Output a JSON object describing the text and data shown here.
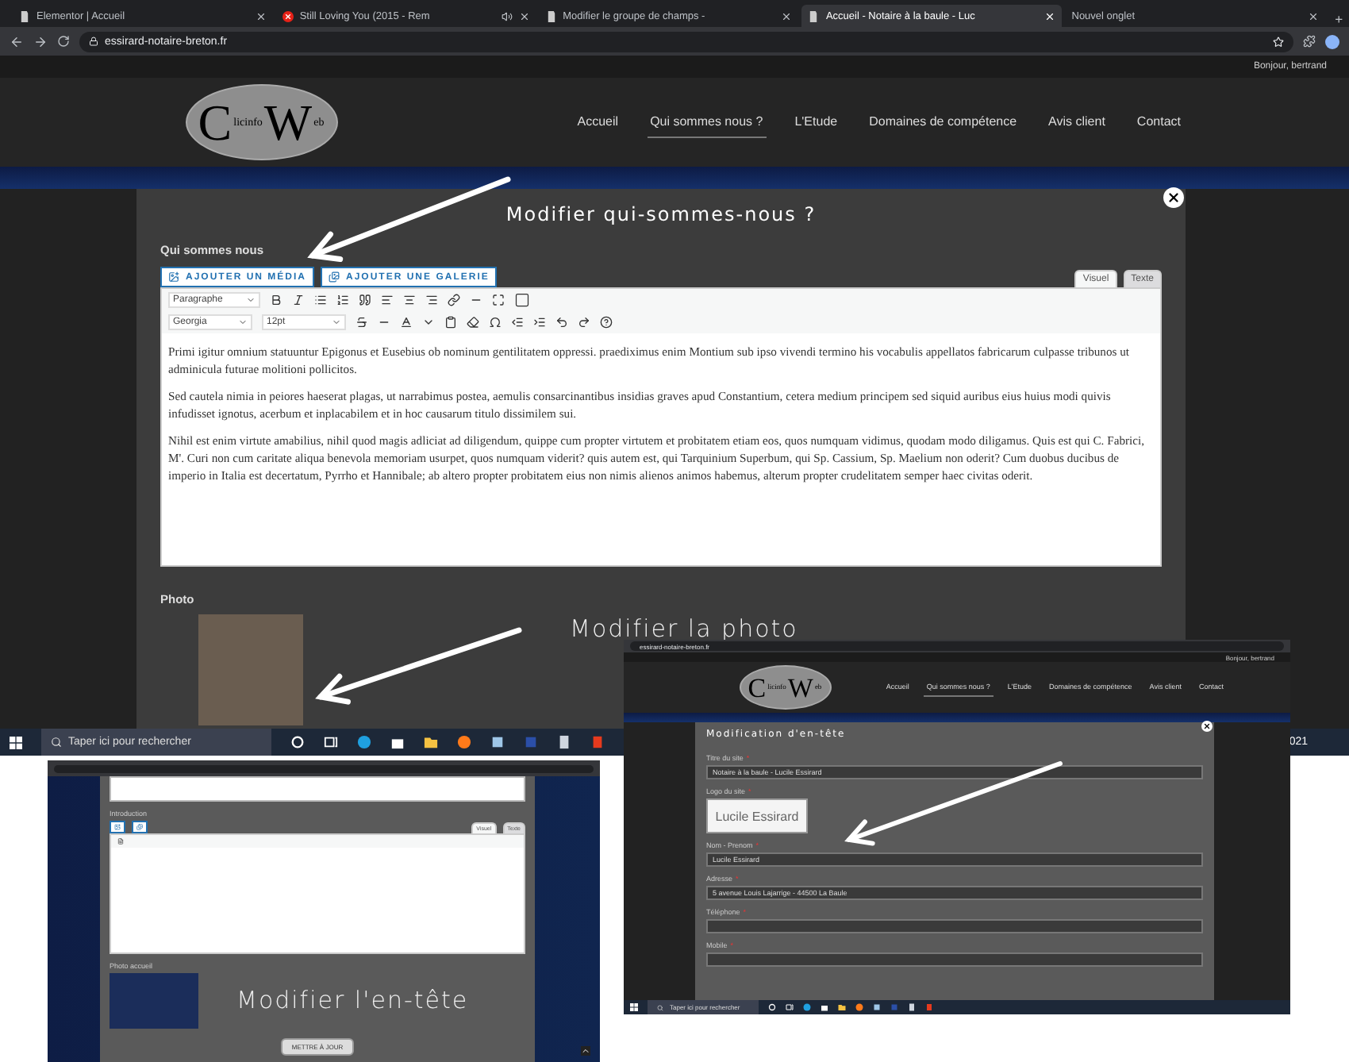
{
  "browser": {
    "tabs": [
      {
        "title": "Elementor | Accueil",
        "kind": "page",
        "selected": false
      },
      {
        "title": "Still Loving You (2015 - Rem",
        "kind": "video",
        "selected": false
      },
      {
        "title": "Modifier le groupe de champs -",
        "kind": "page",
        "selected": false
      },
      {
        "title": "Accueil - Notaire à la baule - Luc",
        "kind": "page",
        "selected": true
      },
      {
        "title": "Nouvel onglet",
        "kind": "blank",
        "selected": false
      }
    ],
    "new_tab": "+",
    "url": "essirard-notaire-breton.fr"
  },
  "site": {
    "greeting": "Bonjour, bertrand",
    "logo": {
      "initial": "C",
      "initial_tail": "licinfo",
      "second": "W",
      "second_tail": "eb"
    },
    "nav": [
      {
        "label": "Accueil",
        "selected": false
      },
      {
        "label": "Qui sommes nous ?",
        "selected": true
      },
      {
        "label": "L'Etude",
        "selected": false
      },
      {
        "label": "Domaines de compétence",
        "selected": false
      },
      {
        "label": "Avis client",
        "selected": false
      },
      {
        "label": "Contact",
        "selected": false
      }
    ]
  },
  "modal": {
    "title": "Modifier qui-sommes-nous ?",
    "field_label": "Qui sommes nous",
    "media_buttons": [
      "AJOUTER UN MÉDIA",
      "AJOUTER UNE GALERIE"
    ],
    "editor_tabs": [
      {
        "label": "Visuel",
        "selected": true
      },
      {
        "label": "Texte",
        "selected": false
      }
    ],
    "format_select": "Paragraphe",
    "font_select": "Georgia",
    "size_select": "12pt",
    "paragraphs": [
      "Primi igitur omnium statuuntur Epigonus et Eusebius ob nominum gentilitatem oppressi. praediximus enim Montium sub ipso vivendi termino his vocabulis appellatos fabricarum culpasse tribunos ut adminicula futurae molitioni pollicitos.",
      "Sed cautela nimia in peiores haeserat plagas, ut narrabimus postea, aemulis consarcinantibus insidias graves apud Constantium, cetera medium principem sed siquid auribus eius huius modi quivis infudisset ignotus, acerbum et inplacabilem et in hoc causarum titulo dissimilem sui.",
      "Nihil est enim virtute amabilius, nihil quod magis adliciat ad diligendum, quippe cum propter virtutem et probitatem etiam eos, quos numquam vidimus, quodam modo diligamus. Quis est qui C. Fabrici, M'. Curi non cum caritate aliqua benevola memoriam usurpet, quos numquam viderit? quis autem est, qui Tarquinium Superbum, qui Sp. Cassium, Sp. Maelium non oderit? Cum duobus ducibus de imperio in Italia est decertatum, Pyrrho et Hannibale; ab altero propter probitatem eius non nimis alienos animos habemus, alterum propter crudelitatem semper haec civitas oderit."
    ],
    "photo_label": "Photo",
    "annotation": "Modifier la photo"
  },
  "taskbar": {
    "search_placeholder": "Taper ici pour rechercher",
    "clock": "021"
  },
  "inset_header": {
    "url": "essirard-notaire-breton.fr",
    "greeting": "Bonjour, bertrand",
    "logo": {
      "initial": "C",
      "initial_tail": "licinfo",
      "second": "W",
      "second_tail": "eb"
    },
    "nav": [
      {
        "label": "Accueil",
        "selected": false
      },
      {
        "label": "Qui sommes nous ?",
        "selected": true
      },
      {
        "label": "L'Etude",
        "selected": false
      },
      {
        "label": "Domaines de compétence",
        "selected": false
      },
      {
        "label": "Avis client",
        "selected": false
      },
      {
        "label": "Contact",
        "selected": false
      }
    ],
    "modal_title": "Modification d'en-tête",
    "fields": [
      {
        "label": "Titre du site",
        "mark": "*",
        "kind": "text",
        "value": "Notaire à la baule - Lucile Essirard"
      },
      {
        "label": "Logo du site",
        "mark": "*",
        "kind": "image",
        "value": "Lucile Essirard"
      },
      {
        "label": "Nom - Prenom",
        "mark": "*",
        "kind": "text",
        "value": "Lucile Essirard"
      },
      {
        "label": "Adresse",
        "mark": "*",
        "kind": "text",
        "value": "5 avenue Louis Lajarrige - 44500 La Baule"
      },
      {
        "label": "Téléphone",
        "mark": "*",
        "kind": "text"
      },
      {
        "label": "Mobile",
        "mark": "*",
        "kind": "text"
      }
    ],
    "search_placeholder": "Taper ici pour rechercher"
  },
  "inset_home": {
    "field_label": "Introduction",
    "editor_tabs": [
      {
        "label": "Visuel",
        "selected": true
      },
      {
        "label": "Texte",
        "selected": false
      }
    ],
    "photo_label": "Photo accueil",
    "annotation": "Modifier l'en-tête",
    "submit": "METTRE À JOUR"
  }
}
